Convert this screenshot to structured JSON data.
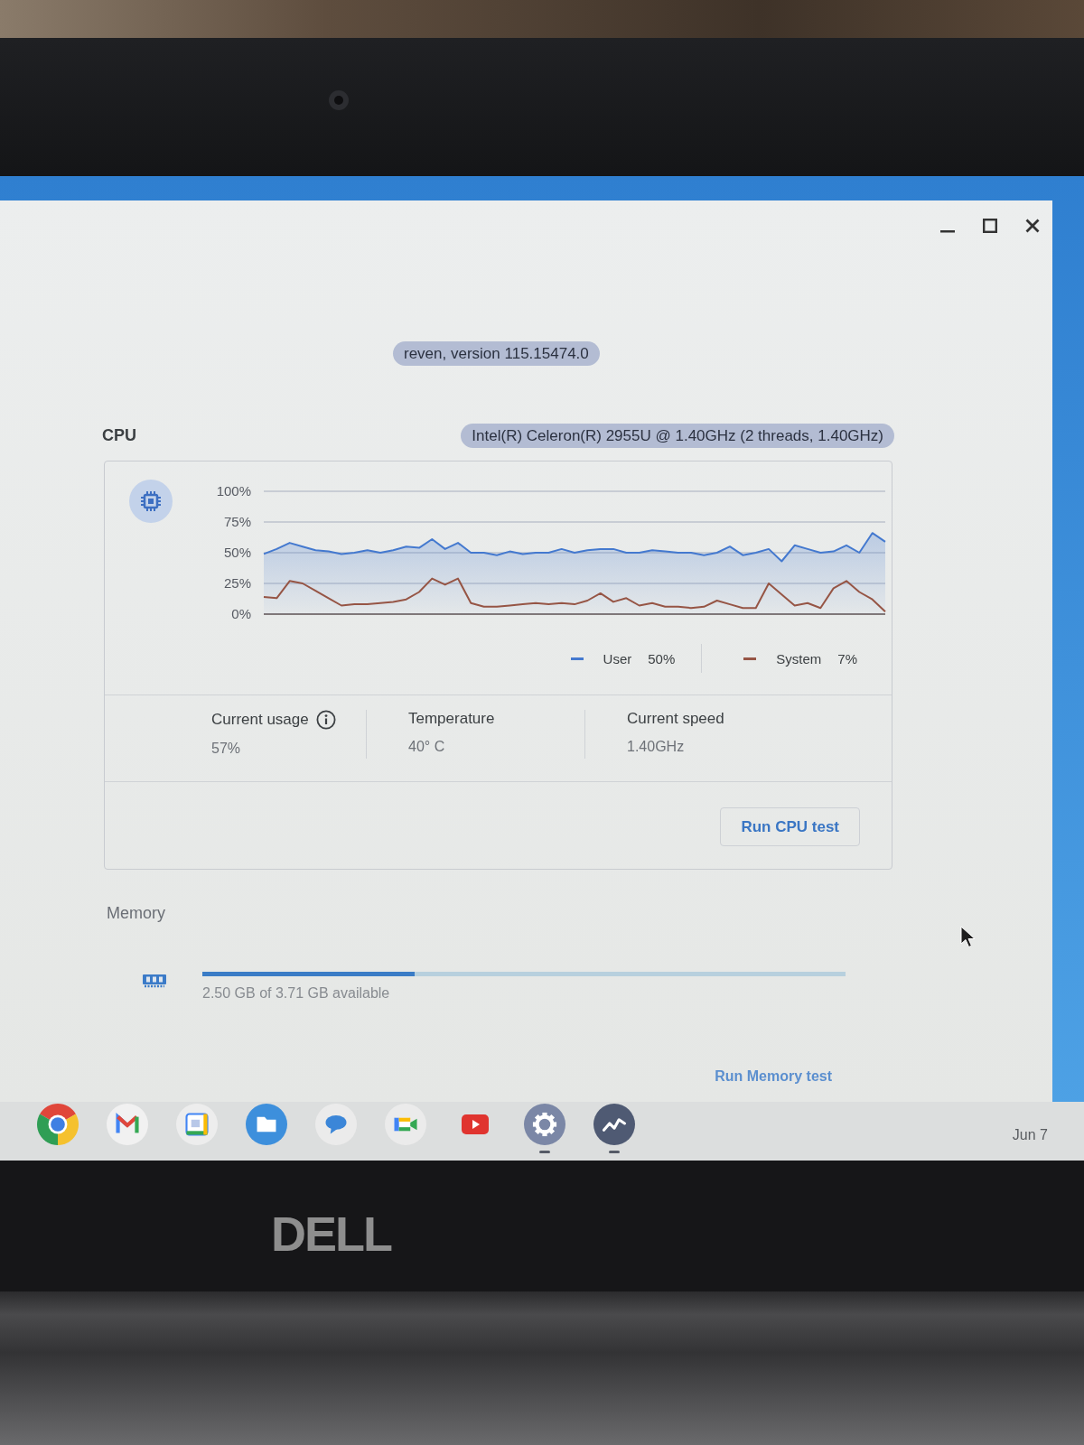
{
  "version": "reven, version 115.15474.0",
  "cpu": {
    "title": "CPU",
    "model": "Intel(R) Celeron(R) 2955U @ 1.40GHz (2 threads, 1.40GHz)",
    "chart_data": {
      "type": "area",
      "grid": true,
      "ylim": [
        0,
        100
      ],
      "yticks": [
        {
          "value": 100,
          "label": "100%"
        },
        {
          "value": 75,
          "label": "75%"
        },
        {
          "value": 50,
          "label": "50%"
        },
        {
          "value": 25,
          "label": "25%"
        },
        {
          "value": 0,
          "label": "0%"
        }
      ],
      "series": [
        {
          "name": "User",
          "color": "#4479cf",
          "values": [
            49,
            53,
            58,
            55,
            52,
            51,
            49,
            50,
            52,
            50,
            52,
            55,
            54,
            61,
            53,
            58,
            50,
            50,
            48,
            51,
            49,
            50,
            50,
            53,
            50,
            52,
            53,
            53,
            50,
            50,
            52,
            51,
            50,
            50,
            48,
            50,
            55,
            48,
            50,
            53,
            43,
            56,
            53,
            50,
            51,
            56,
            50,
            66,
            59
          ]
        },
        {
          "name": "System",
          "type": "line",
          "color": "#965545",
          "values": [
            14,
            13,
            27,
            25,
            19,
            13,
            7,
            8,
            8,
            9,
            10,
            12,
            18,
            29,
            24,
            29,
            9,
            6,
            6,
            7,
            8,
            9,
            8,
            9,
            8,
            11,
            17,
            10,
            13,
            7,
            9,
            6,
            6,
            5,
            6,
            11,
            8,
            5,
            5,
            25,
            16,
            7,
            9,
            5,
            21,
            27,
            18,
            12,
            2
          ]
        }
      ]
    },
    "legend": [
      {
        "value": "50%"
      },
      {
        "value": "7%"
      }
    ],
    "stats": [
      {
        "label": "Current usage",
        "value": "57%",
        "info": true
      },
      {
        "label": "Temperature",
        "value": "40° C",
        "info": false
      },
      {
        "label": "Current speed",
        "value": "1.40GHz",
        "info": false
      }
    ],
    "test_button": "Run CPU test"
  },
  "memory": {
    "title": "Memory",
    "level": 0.33,
    "text": "2.50 GB of 3.71 GB available",
    "test_button": "Run Memory test"
  },
  "shelf": {
    "apps": [
      {
        "kind": "browser",
        "running": false
      },
      {
        "kind": "mail",
        "running": false
      },
      {
        "kind": "calendar",
        "running": false
      },
      {
        "kind": "files",
        "running": false
      },
      {
        "kind": "chat",
        "running": false
      },
      {
        "kind": "video",
        "running": false
      },
      {
        "kind": "player",
        "running": false
      },
      {
        "kind": "settings",
        "running": true
      },
      {
        "kind": "diagnostics",
        "running": true
      }
    ],
    "date": "Jun 7"
  },
  "bezel": {
    "logo": "DELL"
  }
}
